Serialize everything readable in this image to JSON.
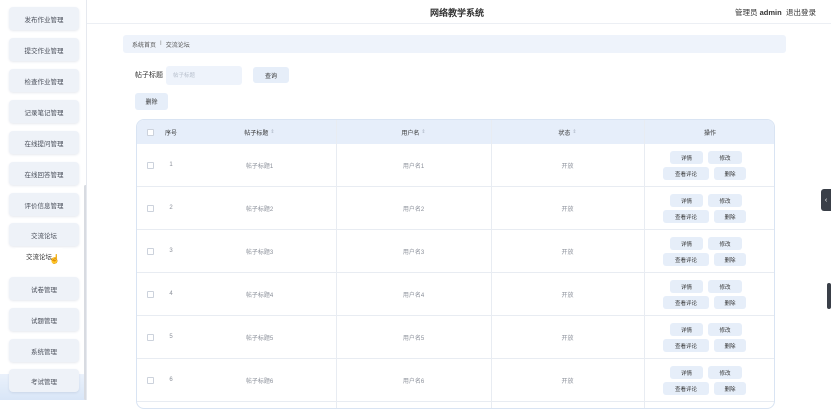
{
  "header": {
    "title": "网络教学系统",
    "user_prefix": "管理员",
    "username": "admin",
    "logout": "退出登录"
  },
  "sidebar": {
    "items": [
      {
        "label": "发布作业管理"
      },
      {
        "label": "提交作业管理"
      },
      {
        "label": "检查作业管理"
      },
      {
        "label": "记录笔记管理"
      },
      {
        "label": "在线提问管理"
      },
      {
        "label": "在线回答管理"
      },
      {
        "label": "评价信息管理"
      },
      {
        "label": "交流论坛"
      },
      {
        "label": "试卷管理"
      },
      {
        "label": "试题管理"
      },
      {
        "label": "系统管理"
      },
      {
        "label": "考试管理"
      }
    ],
    "submenu": {
      "label": "交流论坛"
    }
  },
  "breadcrumb": {
    "home": "系统首页",
    "separator": "I",
    "current": "交流论坛"
  },
  "search": {
    "label": "帖子标题",
    "placeholder": "帖子标题",
    "query_button": "查询",
    "delete_button": "删除"
  },
  "table": {
    "headers": {
      "index": "序号",
      "title": "帖子标题",
      "username": "用户名",
      "status": "状态",
      "actions": "操作"
    },
    "sort_icon": "sort-icon",
    "action_labels": {
      "detail": "详情",
      "edit": "修改",
      "view_comments": "查看评论",
      "delete": "删除"
    },
    "rows": [
      {
        "index": "1",
        "title": "帖子标题1",
        "username": "用户名1",
        "status": "开放"
      },
      {
        "index": "2",
        "title": "帖子标题2",
        "username": "用户名2",
        "status": "开放"
      },
      {
        "index": "3",
        "title": "帖子标题3",
        "username": "用户名3",
        "status": "开放"
      },
      {
        "index": "4",
        "title": "帖子标题4",
        "username": "用户名4",
        "status": "开放"
      },
      {
        "index": "5",
        "title": "帖子标题5",
        "username": "用户名5",
        "status": "开放"
      },
      {
        "index": "6",
        "title": "帖子标题6",
        "username": "用户名6",
        "status": "开放"
      }
    ]
  },
  "colors": {
    "accent_bg": "#e6eef9",
    "header_bg": "#e6eefa",
    "breadcrumb_bg": "#eef3fb"
  }
}
